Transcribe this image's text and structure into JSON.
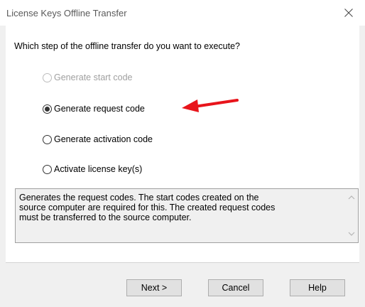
{
  "window": {
    "title": "License Keys Offline Transfer",
    "close_icon": "close-icon"
  },
  "main": {
    "question": "Which step of the offline transfer do you want to execute?",
    "options": [
      {
        "label": "Generate start code",
        "selected": false,
        "disabled": true
      },
      {
        "label": "Generate request code",
        "selected": true,
        "disabled": false
      },
      {
        "label": "Generate activation code",
        "selected": false,
        "disabled": false
      },
      {
        "label": "Activate license key(s)",
        "selected": false,
        "disabled": false
      }
    ],
    "description_lines": [
      "Generates the request codes. The start codes created on the",
      "source computer are  required for this. The created request codes",
      "must be transferred to the source computer."
    ]
  },
  "annotation": {
    "arrow_icon": "red-arrow-icon",
    "arrow_color": "#e8141b"
  },
  "footer": {
    "next_label": "Next >",
    "cancel_label": "Cancel",
    "help_label": "Help"
  }
}
